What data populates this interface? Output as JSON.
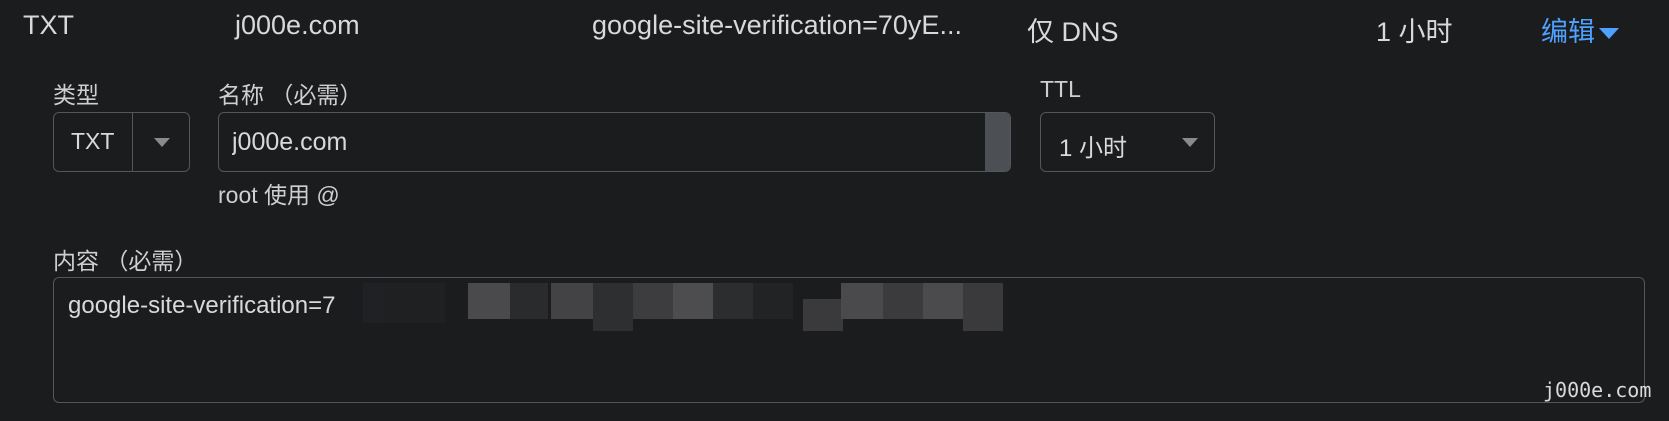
{
  "record": {
    "type": "TXT",
    "name": "j000e.com",
    "content_preview": "google-site-verification=70yE...",
    "proxy_status": "仅 DNS",
    "ttl": "1 小时",
    "edit_label": "编辑"
  },
  "form": {
    "type_label": "类型",
    "type_value": "TXT",
    "name_label": "名称 （必需）",
    "name_value": "j000e.com",
    "name_hint": "root 使用 @",
    "ttl_label": "TTL",
    "ttl_value": "1 小时",
    "content_label": "内容 （必需）",
    "content_value": "google-site-verification=7"
  },
  "watermark": "j000e.com",
  "colors": {
    "background": "#1b1c1e",
    "accent": "#4ea1ff",
    "border": "#55565a"
  }
}
